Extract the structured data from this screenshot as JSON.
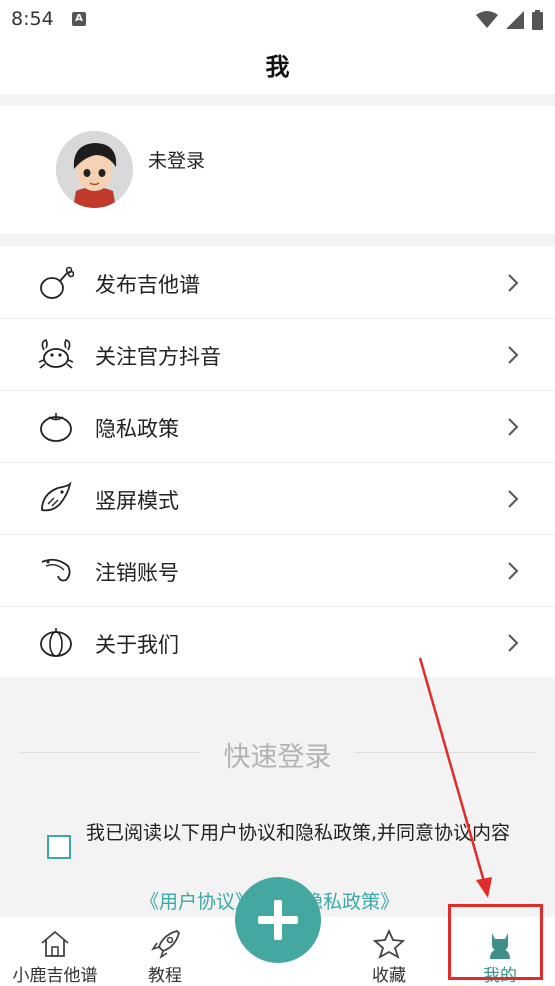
{
  "status_bar": {
    "time": "8:54",
    "badge": "A",
    "icons": [
      "wifi-icon",
      "signal-icon",
      "battery-icon"
    ]
  },
  "header": {
    "title": "我"
  },
  "profile": {
    "name": "未登录",
    "avatar": "avatar-cartoon-boy"
  },
  "menu": {
    "items": [
      {
        "label": "发布吉他谱",
        "icon": "chicken-leg-icon"
      },
      {
        "label": "关注官方抖音",
        "icon": "crab-icon"
      },
      {
        "label": "隐私政策",
        "icon": "tomato-icon"
      },
      {
        "label": "竖屏模式",
        "icon": "fish-icon"
      },
      {
        "label": "注销账号",
        "icon": "shrimp-icon"
      },
      {
        "label": "关于我们",
        "icon": "pumpkin-icon"
      }
    ]
  },
  "login": {
    "title": "快速登录",
    "agree_text": "我已阅读以下用户协议和隐私政策,并同意协议内容",
    "links": "《用户协议》 与 《隐私政策》"
  },
  "tabbar": {
    "tabs": [
      {
        "label": "小鹿吉他谱",
        "icon": "home-icon"
      },
      {
        "label": "教程",
        "icon": "rocket-icon"
      },
      {
        "label": "收藏",
        "icon": "star-icon"
      },
      {
        "label": "我的",
        "icon": "cat-icon"
      }
    ],
    "fab_icon": "plus-icon"
  },
  "colors": {
    "accent": "#45a8a0",
    "highlight": "#e22b2b",
    "separator": "#f3f3f3"
  }
}
